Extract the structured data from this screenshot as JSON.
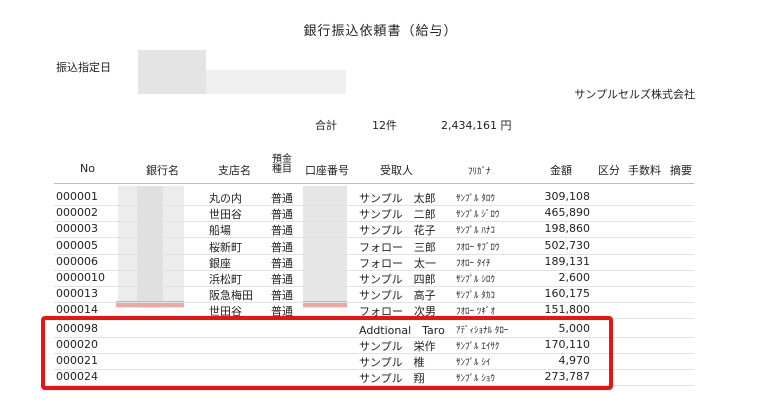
{
  "title": "銀行振込依頼書（給与）",
  "date_label": "振込指定日",
  "company": "サンプルセルズ株式会社",
  "summary": {
    "label": "合計",
    "count": "12件",
    "amount": "2,434,161 円"
  },
  "headers": {
    "no": "No",
    "bank": "銀行名",
    "branch": "支店名",
    "deposit_type_1": "預金",
    "deposit_type_2": "種目",
    "account": "口座番号",
    "recipient": "受取人",
    "kana": "ﾌﾘｶﾞﾅ",
    "amount": "金額",
    "category": "区分",
    "fee": "手数料",
    "summary": "摘要"
  },
  "rows": [
    {
      "no": "000001",
      "branch": "丸の内",
      "type": "普通",
      "name": "サンプル　太郎",
      "kana": "ｻﾝﾌﾟﾙ ﾀﾛｳ",
      "amount": "309,108"
    },
    {
      "no": "000002",
      "branch": "世田谷",
      "type": "普通",
      "name": "サンプル　二郎",
      "kana": "ｻﾝﾌﾟﾙ ｼﾞﾛｳ",
      "amount": "465,890"
    },
    {
      "no": "000003",
      "branch": "船場",
      "type": "普通",
      "name": "サンプル　花子",
      "kana": "ｻﾝﾌﾟﾙ ﾊﾅｺ",
      "amount": "198,860"
    },
    {
      "no": "000005",
      "branch": "桜新町",
      "type": "普通",
      "name": "フォロー　三郎",
      "kana": "ﾌｵﾛｰ ｻﾌﾞﾛｳ",
      "amount": "502,730"
    },
    {
      "no": "000006",
      "branch": "銀座",
      "type": "普通",
      "name": "フォロー　太一",
      "kana": "ﾌｵﾛｰ ﾀｲﾁ",
      "amount": "189,131"
    },
    {
      "no": "0000010",
      "branch": "浜松町",
      "type": "普通",
      "name": "サンプル　四郎",
      "kana": "ｻﾝﾌﾟﾙ ｼﾛｳ",
      "amount": "2,600"
    },
    {
      "no": "000013",
      "branch": "阪急梅田",
      "type": "普通",
      "name": "サンプル　高子",
      "kana": "ｻﾝﾌﾟﾙ ﾀｶｺ",
      "amount": "160,175"
    },
    {
      "no": "000014",
      "branch": "世田谷",
      "type": "普通",
      "name": "フォロー　次男",
      "kana": "ﾌｵﾛｰ ﾂｷﾞｵ",
      "amount": "151,800"
    },
    {
      "no": "000098",
      "branch": "",
      "type": "",
      "name": "Addtional　Taro",
      "kana": "ｱﾃﾞｨｼｮﾅﾙ ﾀﾛｰ",
      "amount": "5,000"
    },
    {
      "no": "000020",
      "branch": "",
      "type": "",
      "name": "サンプル　栄作",
      "kana": "ｻﾝﾌﾟﾙ ｴｲｻｸ",
      "amount": "170,110"
    },
    {
      "no": "000021",
      "branch": "",
      "type": "",
      "name": "サンプル　椎",
      "kana": "ｻﾝﾌﾟﾙ ｼｲ",
      "amount": "4,970"
    },
    {
      "no": "000024",
      "branch": "",
      "type": "",
      "name": "サンプル　翔",
      "kana": "ｻﾝﾌﾟﾙ ｼｮｳ",
      "amount": "273,787"
    }
  ]
}
